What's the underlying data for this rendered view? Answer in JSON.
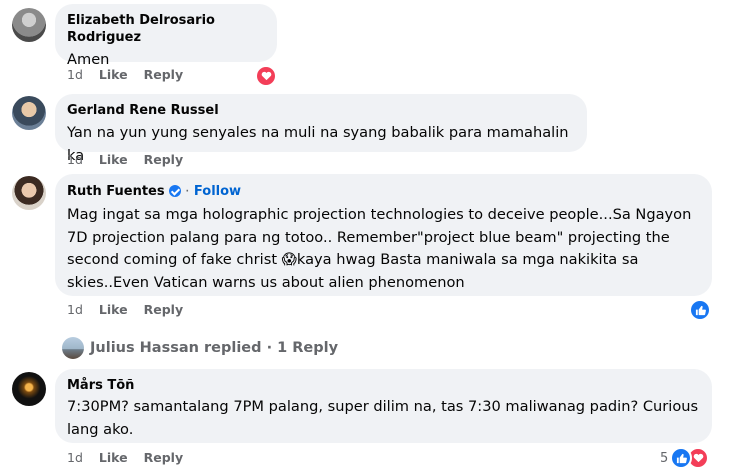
{
  "comments": [
    {
      "author": "Elizabeth Delrosario Rodriguez",
      "text": [
        "Amen"
      ],
      "time": "1d",
      "like_label": "Like",
      "reply_label": "Reply",
      "reaction_icon": "heart-icon"
    },
    {
      "author": "Gerland Rene Russel",
      "text": [
        "Yan na yun yung senyales na muli na syang babalik para mamahalin ka"
      ],
      "time": "1d",
      "like_label": "Like",
      "reply_label": "Reply"
    },
    {
      "author": "Ruth Fuentes",
      "verified_icon": "verified-badge-icon",
      "follow_label": "Follow",
      "text": [
        "Mag ingat sa mga holographic projection technologies to deceive people...Sa Ngayon",
        "7D projection palang para ng totoo.. Remember\"project blue beam\" projecting the",
        "second coming of fake christ 😱kaya hwag Basta maniwala sa mga nakikita sa",
        "skies..Even Vatican warns us about alien phenomenon"
      ],
      "time": "1d",
      "like_label": "Like",
      "reply_label": "Reply",
      "reaction_icon": "like-icon"
    },
    {
      "author": "Mårs Tōñ",
      "text": [
        "7:30PM? samantalang 7PM palang, super dilim na, tas 7:30 maliwanag padin? Curious",
        "lang ako."
      ],
      "time": "1d",
      "like_label": "Like",
      "reply_label": "Reply",
      "reaction_count": "5",
      "reaction_icons": [
        "like-icon",
        "heart-icon"
      ]
    }
  ],
  "replies_summary": {
    "text": "Julius Hassan replied · 1 Reply"
  },
  "colors": {
    "bubble": "#f0f2f5",
    "meta_text": "#65676b",
    "link_blue": "#0064d1",
    "like_blue": "#1877f2",
    "heart_red": "#f33e58"
  }
}
